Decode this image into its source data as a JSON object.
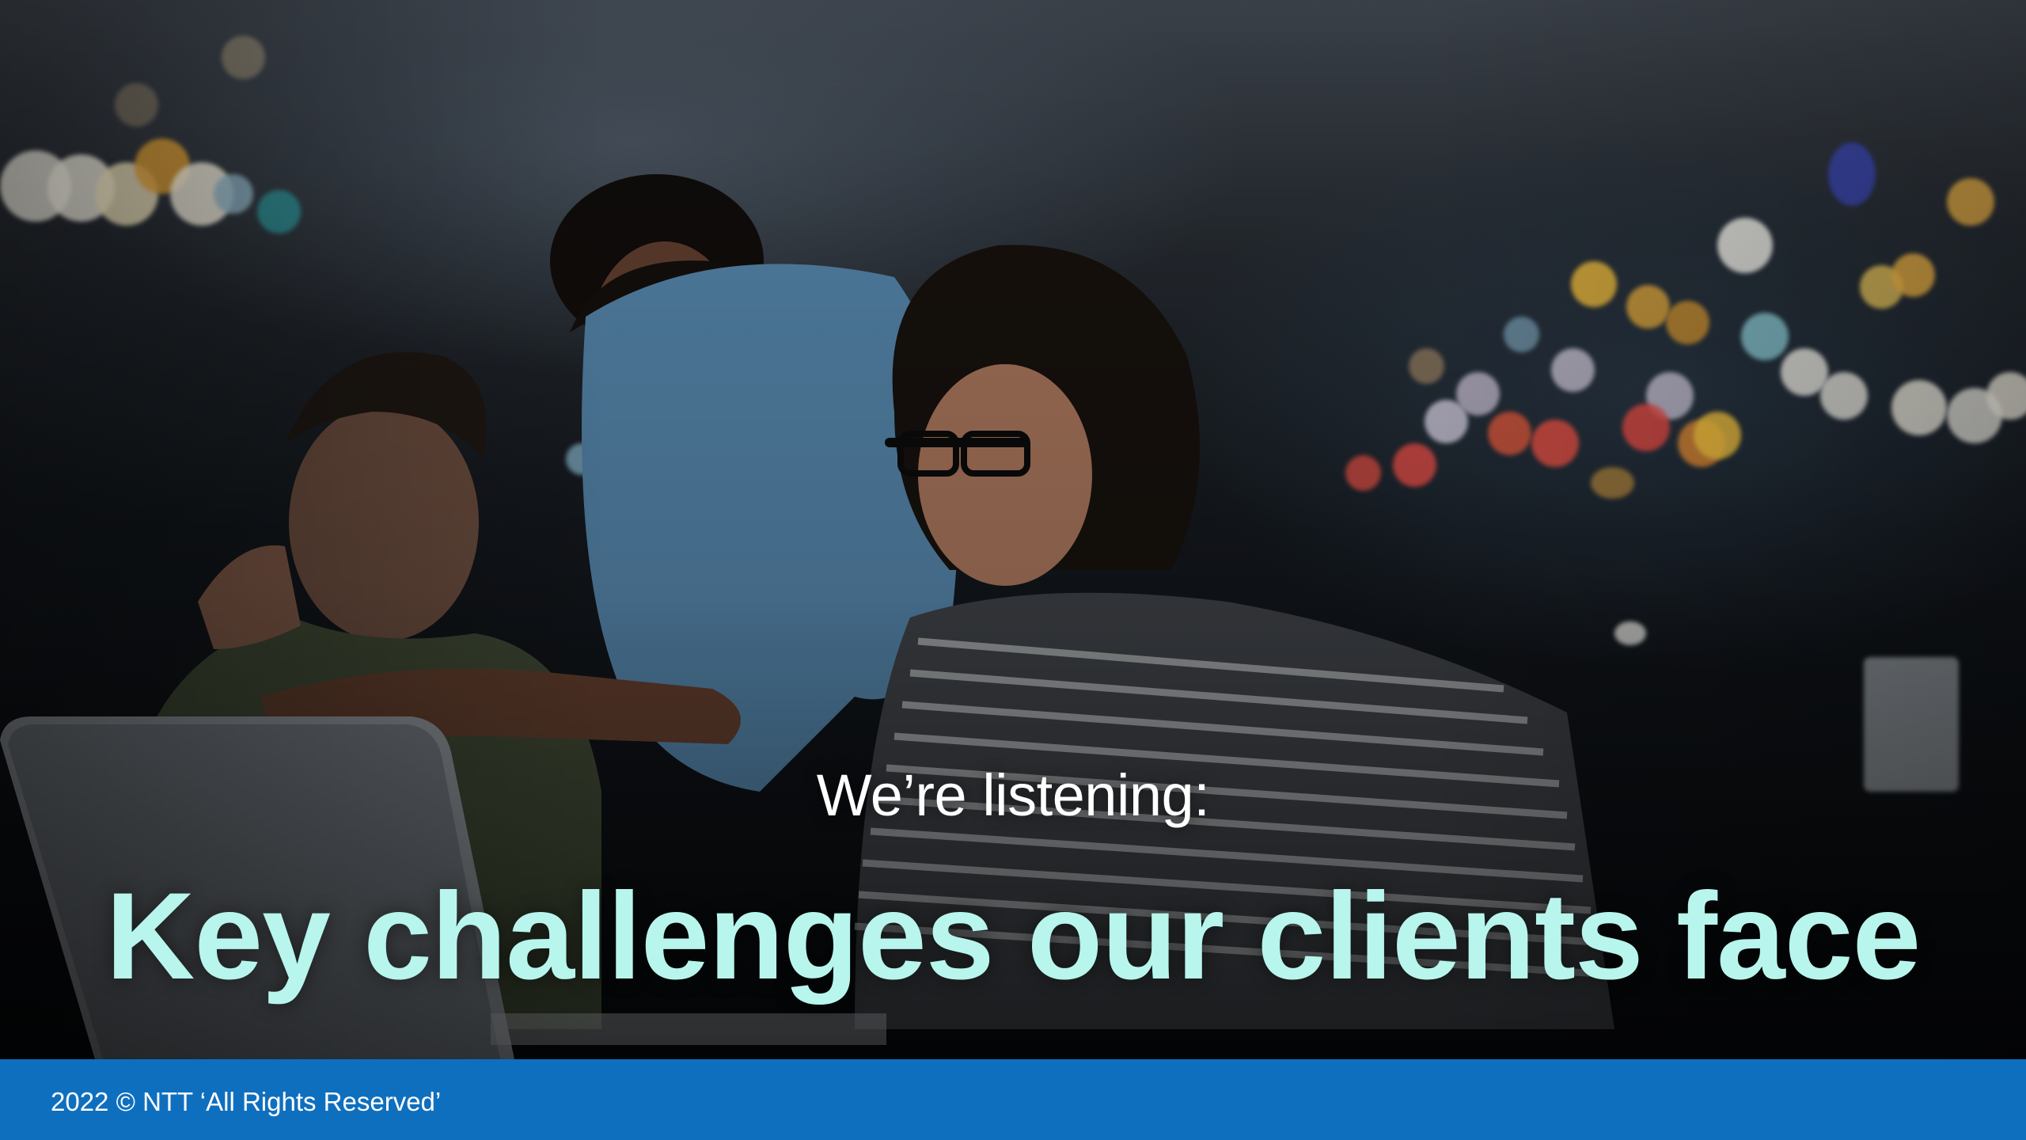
{
  "slide": {
    "subtitle": "We’re listening:",
    "title": "Key challenges our clients face"
  },
  "footer": {
    "copyright": "2022 © NTT ‘All Rights Reserved’"
  },
  "colors": {
    "title": "#b8f5ec",
    "subtitle": "#ffffff",
    "footer_bar": "#0f6fbf",
    "footer_text": "#ffffff"
  }
}
